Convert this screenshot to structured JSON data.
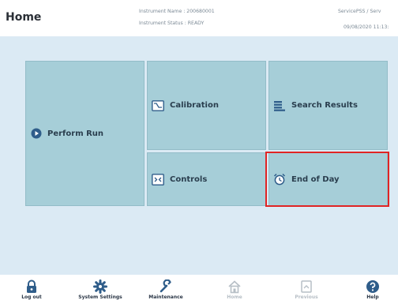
{
  "header": {
    "title": "Home",
    "instrument_name": "Instrument Name : 200680001",
    "instrument_status": "Instrument Status : READY",
    "user": "ServicePSS / Serv",
    "datetime": "09/08/2020 11:13:"
  },
  "tiles": {
    "perform_run": "Perform Run",
    "calibration": "Calibration",
    "search_results": "Search Results",
    "controls": "Controls",
    "end_of_day": "End of Day"
  },
  "footer": {
    "logout": "Log out",
    "system_settings": "System Settings",
    "maintenance": "Maintenance",
    "home": "Home",
    "previous": "Previous",
    "help": "Help"
  },
  "colors": {
    "tile": "#a6ced8",
    "background": "#dbeaf4",
    "icon": "#2f5d8a",
    "highlight": "#e02424"
  }
}
